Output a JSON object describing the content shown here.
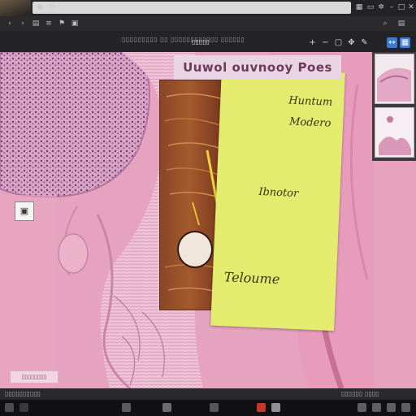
{
  "window": {
    "toolbar_title": "▯▯▯▯▯",
    "toolbar_caption": "▯▯▯▯▯▯▯▯▯ ▯▯ ▯▯▯▯▯▯▯▯▯▯▯▯ ▯▯▯▯▯▯"
  },
  "top_icons": [
    "camera-icon",
    "refresh-icon",
    "grid-icon",
    "folder-icon",
    "settings-icon",
    "minimize-icon",
    "maximize-icon",
    "close-icon"
  ],
  "menu_icons": [
    "back-icon",
    "forward-icon",
    "open-icon",
    "layers-icon",
    "bookmark-icon",
    "window-icon",
    "search-icon",
    "tile-icon"
  ],
  "toolbar_buttons": [
    {
      "name": "zoom-in-button",
      "glyph": "+"
    },
    {
      "name": "zoom-out-button",
      "glyph": "−"
    },
    {
      "name": "fit-button",
      "glyph": "▢"
    },
    {
      "name": "pan-button",
      "glyph": "✥"
    },
    {
      "name": "annotate-button",
      "glyph": "✎"
    },
    {
      "name": "measure-button",
      "glyph": "↔"
    },
    {
      "name": "layout-button",
      "glyph": "▦"
    }
  ],
  "slide": {
    "overlay_title": "Uuwol ouvnooy Poes",
    "annotations": {
      "top_1": "Huntum",
      "top_2": "Modero",
      "middle": "Ibnotor",
      "bottom": "Teloume"
    },
    "scale_bar": "▯▯▯▯▯▯▯▯"
  },
  "status": {
    "left": "▯▯▯▯▯▯▯▯▯▯",
    "right": "▯▯▯▯▯▯ ▯▯▯▯"
  },
  "colors": {
    "tissue_pink": "#e6a3bf",
    "annotation_yellow": "#e3ec6f",
    "tissue_brown": "#8a4626",
    "ui_dark": "#232326",
    "accent_blue": "#3a7bd5"
  }
}
